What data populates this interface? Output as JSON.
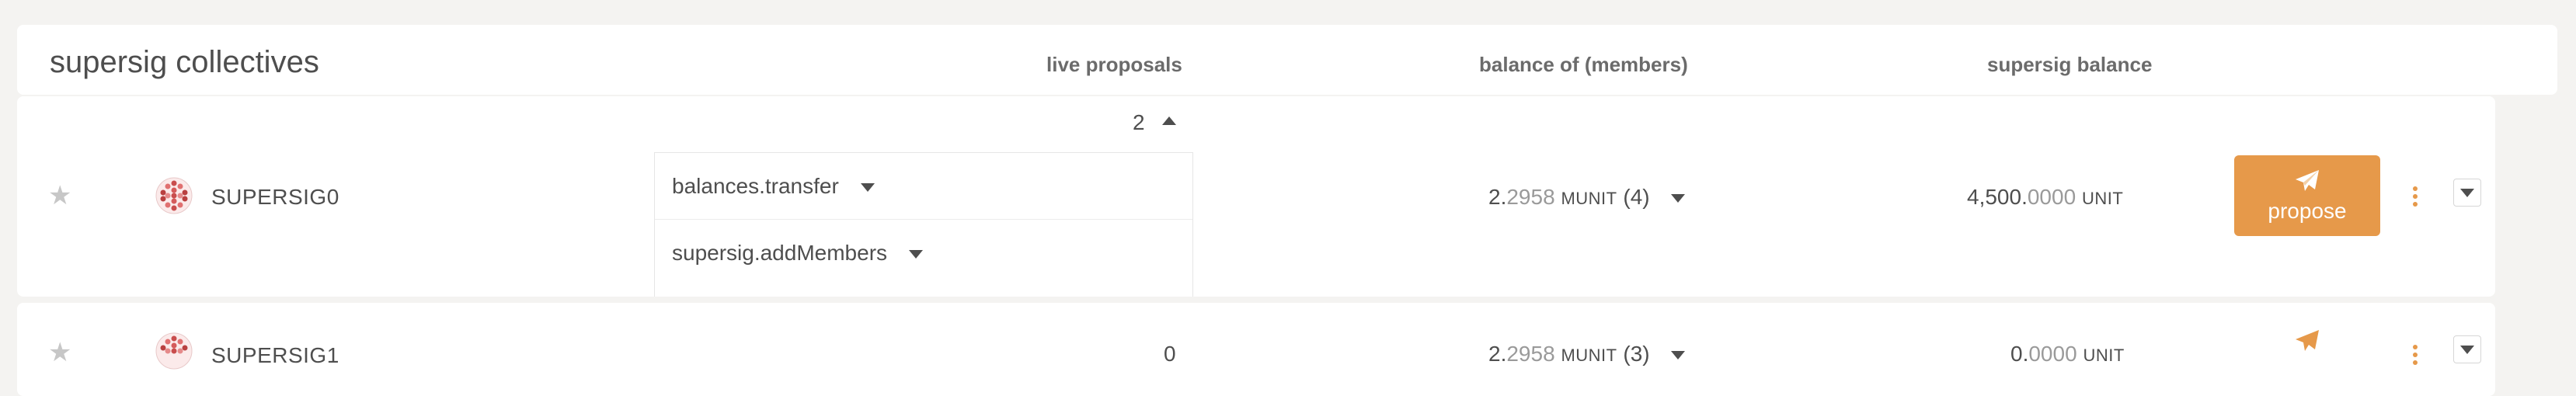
{
  "header": {
    "title": "supersig collectives",
    "columns": {
      "live_proposals": "live proposals",
      "balance_of_members": "balance of (members)",
      "supersig_balance": "supersig balance"
    }
  },
  "rows": [
    {
      "name": "SUPERSIG0",
      "proposal_count": "2",
      "proposals": [
        "balances.transfer",
        "supersig.addMembers"
      ],
      "members_balance": {
        "int": "2.",
        "dec": "2958",
        "unit": "MUNIT",
        "members": "(4)"
      },
      "supersig_balance": {
        "int": "4,500.",
        "dec": "0000",
        "unit": "UNIT"
      },
      "action_label": "propose"
    },
    {
      "name": "SUPERSIG1",
      "proposal_count": "0",
      "members_balance": {
        "int": "2.",
        "dec": "2958",
        "unit": "MUNIT",
        "members": "(3)"
      },
      "supersig_balance": {
        "int": "0.",
        "dec": "0000",
        "unit": "UNIT"
      }
    }
  ],
  "colors": {
    "accent": "#e6994a",
    "text": "#4e4e4e",
    "muted": "#9a9a9a",
    "background": "#f4f3f1"
  },
  "icons": [
    "star-icon",
    "identicon",
    "caret-up-icon",
    "caret-down-icon",
    "paper-plane-icon",
    "kebab-menu-icon"
  ]
}
